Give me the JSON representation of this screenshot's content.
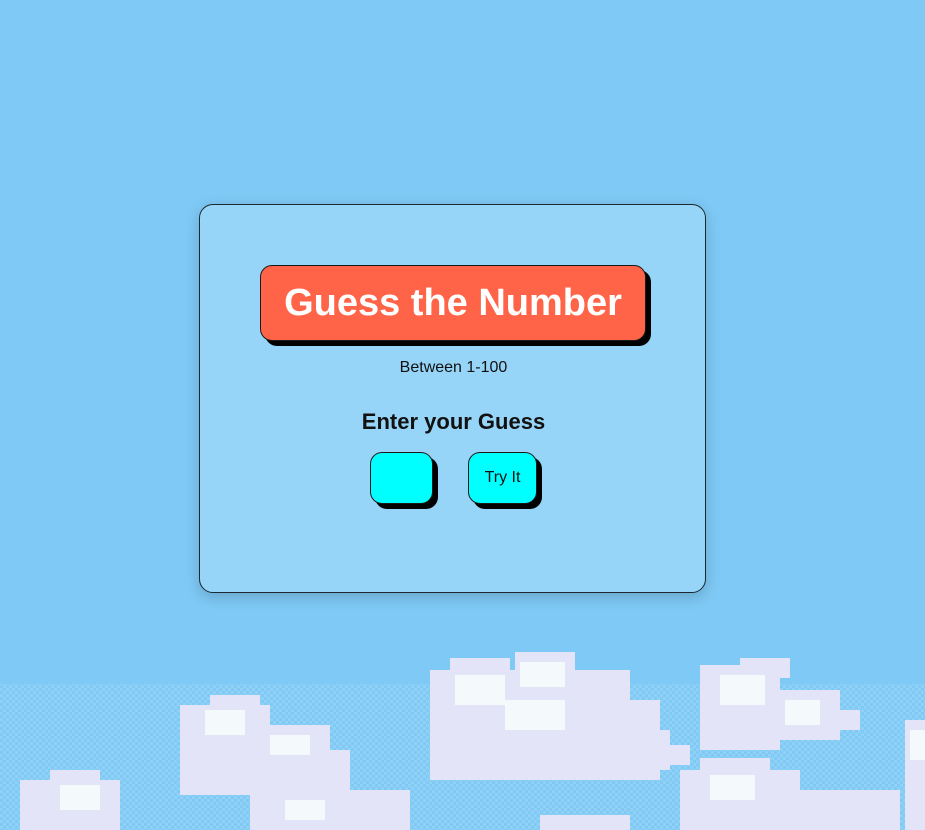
{
  "game": {
    "title": "Guess the Number",
    "range_text": "Between 1-100",
    "prompt": "Enter your Guess",
    "guess_value": "",
    "guess_placeholder": "",
    "submit_label": "Try It"
  },
  "background": {
    "sky_color": "#7ec9f5",
    "cloud_color": "#e3e4f7",
    "cloud_highlight": "#f4f9fb"
  },
  "colors": {
    "card": "#96d5f7",
    "title_bg": "#ff6348",
    "input_bg": "#00ffff"
  }
}
